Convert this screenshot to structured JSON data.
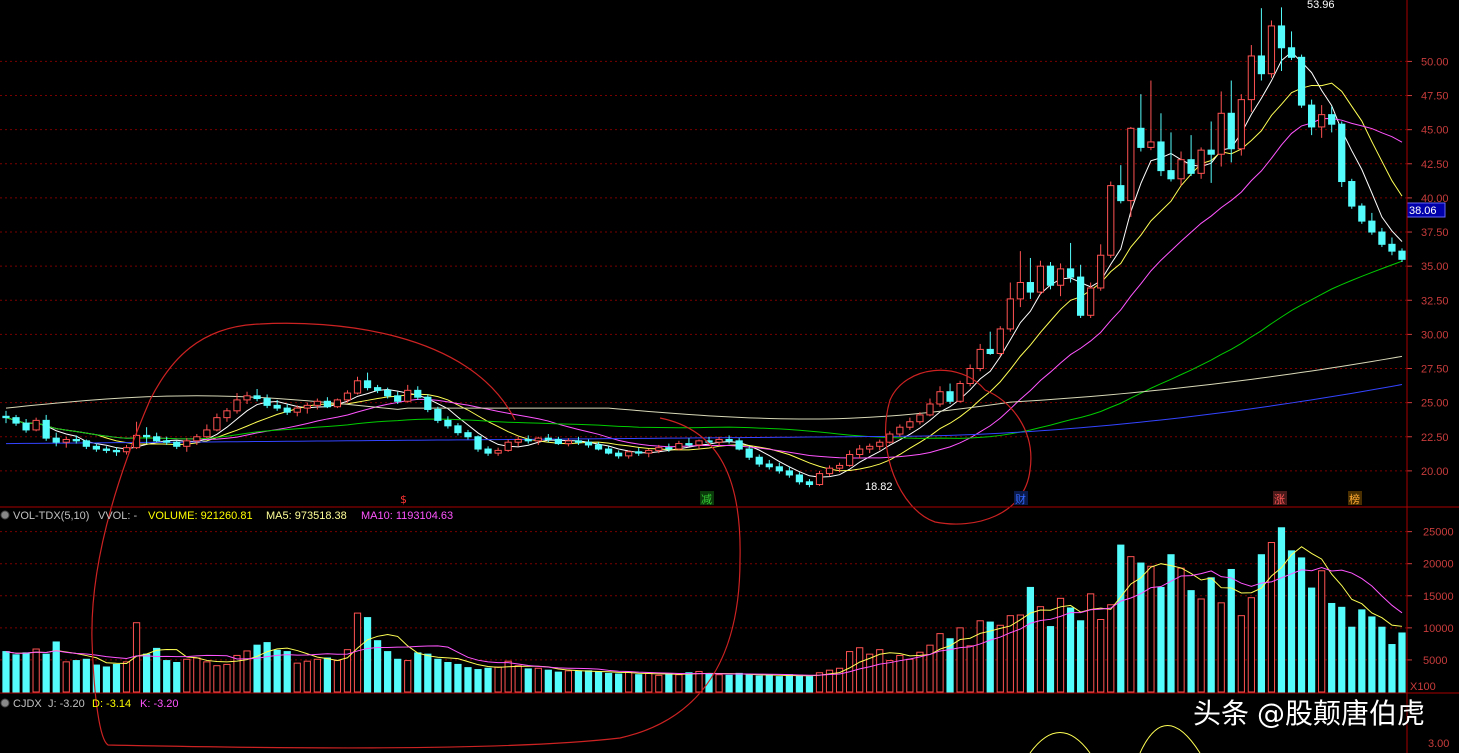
{
  "colors": {
    "background": "#000000",
    "up": "#ff5252",
    "down": "#54fcfc",
    "grid": "#7a0000",
    "axis_text": "#c83c3c",
    "ma5": "#ffffff",
    "ma10": "#ffff55",
    "ma20": "#ff55ff",
    "ma60": "#00cc00",
    "ma120": "#d8d8b8",
    "ma250": "#3344ff",
    "annotation": "#cc2222"
  },
  "price_panel": {
    "high_label": "53.96",
    "low_label": "18.82",
    "current_price": "38.06",
    "markers": [
      {
        "label": "$",
        "color": "#ff3333"
      },
      {
        "label": "减",
        "color": "#33cc33"
      },
      {
        "label": "财",
        "color": "#3366ff"
      },
      {
        "label": "涨",
        "color": "#ff5555"
      },
      {
        "label": "榜",
        "color": "#ffaa33"
      }
    ]
  },
  "volume_panel": {
    "title": "VOL-TDX(5,10)",
    "vvol": "VVOL: -",
    "volume": "VOLUME: 921260.81",
    "ma5": "MA5: 973518.38",
    "ma10": "MA10: 1193104.63",
    "unit": "X100"
  },
  "kdj_panel": {
    "title": "CJDX",
    "j": "J: -3.20",
    "d": "D: -3.14",
    "k": "K: -3.20",
    "axis_labels": [
      "3.00"
    ]
  },
  "watermark": {
    "brand": "头条",
    "handle": "@股颠唐伯虎"
  },
  "chart_data": [
    {
      "type": "candlestick",
      "ylim": [
        17.5,
        54.5
      ],
      "y_ticks": [
        20.0,
        22.5,
        25.0,
        27.5,
        30.0,
        32.5,
        35.0,
        37.5,
        40.0,
        42.5,
        45.0,
        47.5,
        50.0
      ],
      "grid": true,
      "ohlc": [
        [
          24.0,
          24.4,
          23.5,
          23.9
        ],
        [
          23.9,
          24.1,
          23.3,
          23.5
        ],
        [
          23.5,
          23.8,
          22.8,
          23.0
        ],
        [
          23.0,
          23.9,
          22.9,
          23.7
        ],
        [
          23.7,
          24.1,
          22.2,
          22.4
        ],
        [
          22.4,
          22.8,
          21.8,
          22.1
        ],
        [
          22.1,
          22.5,
          21.7,
          22.3
        ],
        [
          22.3,
          22.6,
          22.0,
          22.2
        ],
        [
          22.2,
          22.3,
          21.6,
          21.8
        ],
        [
          21.8,
          22.0,
          21.4,
          21.6
        ],
        [
          21.6,
          21.8,
          21.3,
          21.5
        ],
        [
          21.5,
          21.7,
          21.1,
          21.4
        ],
        [
          21.4,
          21.9,
          21.2,
          21.7
        ],
        [
          21.7,
          23.6,
          21.6,
          22.6
        ],
        [
          22.6,
          23.2,
          22.0,
          22.5
        ],
        [
          22.5,
          22.8,
          22.1,
          22.2
        ],
        [
          22.2,
          22.5,
          21.9,
          22.1
        ],
        [
          22.1,
          22.2,
          21.6,
          21.8
        ],
        [
          21.8,
          22.4,
          21.4,
          22.2
        ],
        [
          22.2,
          22.7,
          21.9,
          22.5
        ],
        [
          22.5,
          23.4,
          22.4,
          23.0
        ],
        [
          23.0,
          24.2,
          22.9,
          23.9
        ],
        [
          23.9,
          24.6,
          23.6,
          24.4
        ],
        [
          24.4,
          25.7,
          24.2,
          25.2
        ],
        [
          25.2,
          25.8,
          24.9,
          25.5
        ],
        [
          25.5,
          26.0,
          25.1,
          25.3
        ],
        [
          25.3,
          25.6,
          24.6,
          24.8
        ],
        [
          24.8,
          25.2,
          24.4,
          24.6
        ],
        [
          24.6,
          24.9,
          24.1,
          24.3
        ],
        [
          24.3,
          24.8,
          24.0,
          24.6
        ],
        [
          24.6,
          25.0,
          24.2,
          24.8
        ],
        [
          24.8,
          25.3,
          24.5,
          25.1
        ],
        [
          25.1,
          25.4,
          24.6,
          24.7
        ],
        [
          24.7,
          25.3,
          24.6,
          25.2
        ],
        [
          25.2,
          25.9,
          25.0,
          25.7
        ],
        [
          25.7,
          26.9,
          25.6,
          26.6
        ],
        [
          26.6,
          27.2,
          25.9,
          26.1
        ],
        [
          26.1,
          26.3,
          25.7,
          25.9
        ],
        [
          25.9,
          26.1,
          25.3,
          25.5
        ],
        [
          25.5,
          25.8,
          24.9,
          25.1
        ],
        [
          25.1,
          26.3,
          25.0,
          25.9
        ],
        [
          25.9,
          26.2,
          25.2,
          25.4
        ],
        [
          25.4,
          25.6,
          24.3,
          24.5
        ],
        [
          24.5,
          24.7,
          23.5,
          23.7
        ],
        [
          23.7,
          24.0,
          23.1,
          23.3
        ],
        [
          23.3,
          23.5,
          22.6,
          22.8
        ],
        [
          22.8,
          23.0,
          22.3,
          22.5
        ],
        [
          22.5,
          22.6,
          21.4,
          21.6
        ],
        [
          21.6,
          21.8,
          21.1,
          21.3
        ],
        [
          21.3,
          21.7,
          21.1,
          21.5
        ],
        [
          21.5,
          22.3,
          21.4,
          22.1
        ],
        [
          22.1,
          22.5,
          21.8,
          22.3
        ],
        [
          22.3,
          22.6,
          22.0,
          22.2
        ],
        [
          22.2,
          22.5,
          21.9,
          22.4
        ],
        [
          22.4,
          22.7,
          22.1,
          22.3
        ],
        [
          22.3,
          22.5,
          21.9,
          22.0
        ],
        [
          22.0,
          22.4,
          21.8,
          22.2
        ],
        [
          22.2,
          22.5,
          21.9,
          22.1
        ],
        [
          22.1,
          22.3,
          21.7,
          21.9
        ],
        [
          21.9,
          22.1,
          21.5,
          21.6
        ],
        [
          21.6,
          21.8,
          21.2,
          21.3
        ],
        [
          21.3,
          21.5,
          20.9,
          21.1
        ],
        [
          21.1,
          21.5,
          20.9,
          21.4
        ],
        [
          21.4,
          21.7,
          21.1,
          21.3
        ],
        [
          21.3,
          21.6,
          21.0,
          21.5
        ],
        [
          21.5,
          21.9,
          21.3,
          21.7
        ],
        [
          21.7,
          22.0,
          21.4,
          21.6
        ],
        [
          21.6,
          22.2,
          21.5,
          22.0
        ],
        [
          22.0,
          22.4,
          21.8,
          21.9
        ],
        [
          21.9,
          22.3,
          21.6,
          22.2
        ],
        [
          22.2,
          22.5,
          21.9,
          22.1
        ],
        [
          22.1,
          22.5,
          21.8,
          22.3
        ],
        [
          22.3,
          22.6,
          22.0,
          22.2
        ],
        [
          22.2,
          22.4,
          21.5,
          21.6
        ],
        [
          21.6,
          21.8,
          20.8,
          21.0
        ],
        [
          21.0,
          21.2,
          20.3,
          20.5
        ],
        [
          20.5,
          20.8,
          20.1,
          20.3
        ],
        [
          20.3,
          20.6,
          19.8,
          20.0
        ],
        [
          20.0,
          20.3,
          19.5,
          19.7
        ],
        [
          19.7,
          19.9,
          19.0,
          19.2
        ],
        [
          19.2,
          19.4,
          18.8,
          19.0
        ],
        [
          19.0,
          20.0,
          18.9,
          19.8
        ],
        [
          19.8,
          20.4,
          19.6,
          20.2
        ],
        [
          20.2,
          20.6,
          19.9,
          20.4
        ],
        [
          20.4,
          21.5,
          20.3,
          21.2
        ],
        [
          21.2,
          21.9,
          20.9,
          21.6
        ],
        [
          21.6,
          22.0,
          21.3,
          21.8
        ],
        [
          21.8,
          22.3,
          21.5,
          22.1
        ],
        [
          22.1,
          22.9,
          22.0,
          22.7
        ],
        [
          22.7,
          23.4,
          22.5,
          23.2
        ],
        [
          23.2,
          23.9,
          23.0,
          23.6
        ],
        [
          23.6,
          24.3,
          23.4,
          24.1
        ],
        [
          24.1,
          25.3,
          24.0,
          24.9
        ],
        [
          24.9,
          26.2,
          24.7,
          25.8
        ],
        [
          25.8,
          26.4,
          24.9,
          25.1
        ],
        [
          25.1,
          26.6,
          25.0,
          26.4
        ],
        [
          26.4,
          27.8,
          26.2,
          27.5
        ],
        [
          27.5,
          29.3,
          27.3,
          28.9
        ],
        [
          28.9,
          30.2,
          28.5,
          28.6
        ],
        [
          28.6,
          30.6,
          28.4,
          30.4
        ],
        [
          30.4,
          33.8,
          30.2,
          32.6
        ],
        [
          32.6,
          36.1,
          32.0,
          33.8
        ],
        [
          33.8,
          35.6,
          32.6,
          33.1
        ],
        [
          33.1,
          35.4,
          32.9,
          35.0
        ],
        [
          35.0,
          35.3,
          33.3,
          33.6
        ],
        [
          33.6,
          35.2,
          32.8,
          34.8
        ],
        [
          34.8,
          36.7,
          33.8,
          34.2
        ],
        [
          34.2,
          35.1,
          31.2,
          31.4
        ],
        [
          31.4,
          33.8,
          31.2,
          33.4
        ],
        [
          33.4,
          36.6,
          33.2,
          35.8
        ],
        [
          35.8,
          41.2,
          35.6,
          40.9
        ],
        [
          40.9,
          42.4,
          39.6,
          39.8
        ],
        [
          39.8,
          45.2,
          38.6,
          45.1
        ],
        [
          45.1,
          47.6,
          43.4,
          43.7
        ],
        [
          43.7,
          48.6,
          43.5,
          44.1
        ],
        [
          44.1,
          46.2,
          41.6,
          42.0
        ],
        [
          42.0,
          44.8,
          41.2,
          41.4
        ],
        [
          41.4,
          43.4,
          40.9,
          42.8
        ],
        [
          42.8,
          44.6,
          41.6,
          41.8
        ],
        [
          41.8,
          43.7,
          41.4,
          43.5
        ],
        [
          43.5,
          45.6,
          41.1,
          43.2
        ],
        [
          43.2,
          47.8,
          42.3,
          46.2
        ],
        [
          46.2,
          48.6,
          42.6,
          43.6
        ],
        [
          43.6,
          47.6,
          43.1,
          47.2
        ],
        [
          47.2,
          51.2,
          46.3,
          50.4
        ],
        [
          50.4,
          53.9,
          48.6,
          49.1
        ],
        [
          49.1,
          53.0,
          48.8,
          52.6
        ],
        [
          52.6,
          53.96,
          49.3,
          51.0
        ],
        [
          51.0,
          52.2,
          50.1,
          50.3
        ],
        [
          50.3,
          50.5,
          46.6,
          46.8
        ],
        [
          46.8,
          47.2,
          44.6,
          45.2
        ],
        [
          45.2,
          46.8,
          44.4,
          46.1
        ],
        [
          46.1,
          46.7,
          44.8,
          45.4
        ],
        [
          45.4,
          45.6,
          40.8,
          41.2
        ],
        [
          41.2,
          41.4,
          39.2,
          39.4
        ],
        [
          39.4,
          39.6,
          38.1,
          38.3
        ],
        [
          38.3,
          38.9,
          37.3,
          37.5
        ],
        [
          37.5,
          37.8,
          36.4,
          36.6
        ],
        [
          36.6,
          37.1,
          35.8,
          36.1
        ],
        [
          36.1,
          36.3,
          35.3,
          35.5
        ]
      ]
    },
    {
      "type": "bar",
      "title": "VOL-TDX(5,10)",
      "unit": "X100",
      "y_ticks": [
        5000,
        10000,
        15000,
        20000,
        25000
      ],
      "ylim": [
        0,
        26500
      ],
      "values": [
        6300,
        5800,
        6100,
        6700,
        5900,
        7800,
        4700,
        4900,
        5100,
        4200,
        3900,
        4300,
        4700,
        10800,
        5900,
        6800,
        4900,
        4600,
        5100,
        5300,
        4700,
        4100,
        4300,
        5700,
        6400,
        7300,
        7700,
        6500,
        6300,
        4500,
        4800,
        5100,
        5300,
        4900,
        6600,
        12300,
        11600,
        8000,
        6300,
        5100,
        4900,
        6100,
        5900,
        5100,
        4600,
        4300,
        3800,
        3500,
        3700,
        3900,
        4800,
        4100,
        3600,
        3700,
        3400,
        3100,
        3300,
        3200,
        3300,
        3100,
        2900,
        2800,
        3100,
        2700,
        2900,
        2600,
        2800,
        2700,
        3000,
        3200,
        2800,
        2700,
        2600,
        2900,
        2700,
        2500,
        2600,
        2400,
        2700,
        2600,
        2400,
        3000,
        3400,
        3700,
        6300,
        6900,
        5900,
        6600,
        4900,
        5700,
        5100,
        6200,
        7300,
        9100,
        8300,
        10000,
        7200,
        11100,
        10900,
        10400,
        11900,
        12000,
        16300,
        13300,
        10200,
        14600,
        13100,
        11100,
        15300,
        11300,
        13600,
        22900,
        21100,
        20100,
        19600,
        16300,
        21400,
        19300,
        15800,
        14500,
        17800,
        13900,
        19100,
        11900,
        14700,
        21400,
        23300,
        25600,
        22000,
        20900,
        16200,
        18900,
        13800,
        13200,
        10100,
        12800,
        11700,
        10100,
        7400,
        9200
      ],
      "ma5_last": 973518.38,
      "ma10_last": 1193104.63
    }
  ]
}
